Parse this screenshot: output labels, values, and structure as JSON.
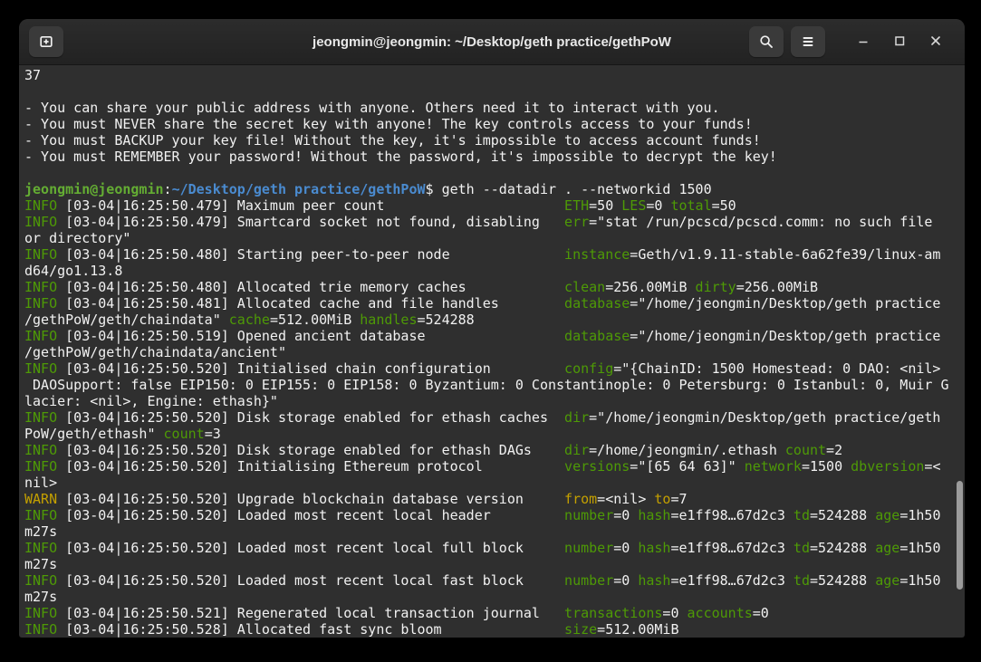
{
  "window": {
    "title": "jeongmin@jeongmin: ~/Desktop/geth practice/gethPoW",
    "controls": [
      "new-tab",
      "search",
      "menu",
      "minimize",
      "maximize",
      "close"
    ]
  },
  "colors": {
    "desktop_bg": "#000000",
    "terminal_bg": "#2f2f2f",
    "titlebar_bg": "#262626",
    "titlebar_button_bg": "#3a3a3a",
    "foreground": "#f1f1f1",
    "info_green": "#4e9a06",
    "warn_yellow": "#c4a000",
    "prompt_user_green": "#64ad33",
    "prompt_path_blue": "#4a8bd0",
    "scrollbar_thumb": "#9b9b9b"
  },
  "terminal": {
    "lines": [
      [
        {
          "c": "f",
          "t": "37"
        }
      ],
      [],
      [
        {
          "c": "f",
          "t": "- You can share your public address with anyone. Others need it to interact with you."
        }
      ],
      [
        {
          "c": "f",
          "t": "- You must NEVER share the secret key with anyone! The key controls access to your funds!"
        }
      ],
      [
        {
          "c": "f",
          "t": "- You must BACKUP your key file! Without the key, it's impossible to access account funds!"
        }
      ],
      [
        {
          "c": "f",
          "t": "- You must REMEMBER your password! Without the password, it's impossible to decrypt the key!"
        }
      ],
      [],
      [
        {
          "c": "u",
          "t": "jeongmin@jeongmin"
        },
        {
          "c": "f",
          "t": ":"
        },
        {
          "c": "p",
          "t": "~/Desktop/geth practice/gethPoW"
        },
        {
          "c": "f",
          "t": "$ geth --datadir . --networkid 1500"
        }
      ],
      [
        {
          "c": "i",
          "t": "INFO"
        },
        {
          "c": "f",
          "t": " [03-04|16:25:50.479] Maximum peer count",
          "pad": 66
        },
        {
          "c": "k",
          "t": "ETH"
        },
        {
          "c": "f",
          "t": "=50 "
        },
        {
          "c": "k",
          "t": "LES"
        },
        {
          "c": "f",
          "t": "=0 "
        },
        {
          "c": "k",
          "t": "total"
        },
        {
          "c": "f",
          "t": "=50"
        }
      ],
      [
        {
          "c": "i",
          "t": "INFO"
        },
        {
          "c": "f",
          "t": " [03-04|16:25:50.479] Smartcard socket not found, disabling",
          "pad": 66
        },
        {
          "c": "k",
          "t": "err"
        },
        {
          "c": "f",
          "t": "=\"stat /run/pcscd/pcscd.comm: no such file"
        }
      ],
      [
        {
          "c": "f",
          "t": "or directory\""
        }
      ],
      [
        {
          "c": "i",
          "t": "INFO"
        },
        {
          "c": "f",
          "t": " [03-04|16:25:50.480] Starting peer-to-peer node",
          "pad": 66
        },
        {
          "c": "k",
          "t": "instance"
        },
        {
          "c": "f",
          "t": "=Geth/v1.9.11-stable-6a62fe39/linux-am"
        }
      ],
      [
        {
          "c": "f",
          "t": "d64/go1.13.8"
        }
      ],
      [
        {
          "c": "i",
          "t": "INFO"
        },
        {
          "c": "f",
          "t": " [03-04|16:25:50.480] Allocated trie memory caches",
          "pad": 66
        },
        {
          "c": "k",
          "t": "clean"
        },
        {
          "c": "f",
          "t": "=256.00MiB "
        },
        {
          "c": "k",
          "t": "dirty"
        },
        {
          "c": "f",
          "t": "=256.00MiB"
        }
      ],
      [
        {
          "c": "i",
          "t": "INFO"
        },
        {
          "c": "f",
          "t": " [03-04|16:25:50.481] Allocated cache and file handles",
          "pad": 66
        },
        {
          "c": "k",
          "t": "database"
        },
        {
          "c": "f",
          "t": "=\"/home/jeongmin/Desktop/geth practice"
        }
      ],
      [
        {
          "c": "f",
          "t": "/gethPoW/geth/chaindata\" "
        },
        {
          "c": "k",
          "t": "cache"
        },
        {
          "c": "f",
          "t": "=512.00MiB "
        },
        {
          "c": "k",
          "t": "handles"
        },
        {
          "c": "f",
          "t": "=524288"
        }
      ],
      [
        {
          "c": "i",
          "t": "INFO"
        },
        {
          "c": "f",
          "t": " [03-04|16:25:50.519] Opened ancient database",
          "pad": 66
        },
        {
          "c": "k",
          "t": "database"
        },
        {
          "c": "f",
          "t": "=\"/home/jeongmin/Desktop/geth practice"
        }
      ],
      [
        {
          "c": "f",
          "t": "/gethPoW/geth/chaindata/ancient\""
        }
      ],
      [
        {
          "c": "i",
          "t": "INFO"
        },
        {
          "c": "f",
          "t": " [03-04|16:25:50.520] Initialised chain configuration",
          "pad": 66
        },
        {
          "c": "k",
          "t": "config"
        },
        {
          "c": "f",
          "t": "=\"{ChainID: 1500 Homestead: 0 DAO: <nil>"
        }
      ],
      [
        {
          "c": "f",
          "t": " DAOSupport: false EIP150: 0 EIP155: 0 EIP158: 0 Byzantium: 0 Constantinople: 0 Petersburg: 0 Istanbul: 0, Muir G"
        }
      ],
      [
        {
          "c": "f",
          "t": "lacier: <nil>, Engine: ethash}\""
        }
      ],
      [
        {
          "c": "i",
          "t": "INFO"
        },
        {
          "c": "f",
          "t": " [03-04|16:25:50.520] Disk storage enabled for ethash caches",
          "pad": 66
        },
        {
          "c": "k",
          "t": "dir"
        },
        {
          "c": "f",
          "t": "=\"/home/jeongmin/Desktop/geth practice/geth"
        }
      ],
      [
        {
          "c": "f",
          "t": "PoW/geth/ethash\" "
        },
        {
          "c": "k",
          "t": "count"
        },
        {
          "c": "f",
          "t": "=3"
        }
      ],
      [
        {
          "c": "i",
          "t": "INFO"
        },
        {
          "c": "f",
          "t": " [03-04|16:25:50.520] Disk storage enabled for ethash DAGs",
          "pad": 66
        },
        {
          "c": "k",
          "t": "dir"
        },
        {
          "c": "f",
          "t": "=/home/jeongmin/.ethash "
        },
        {
          "c": "k",
          "t": "count"
        },
        {
          "c": "f",
          "t": "=2"
        }
      ],
      [
        {
          "c": "i",
          "t": "INFO"
        },
        {
          "c": "f",
          "t": " [03-04|16:25:50.520] Initialising Ethereum protocol",
          "pad": 66
        },
        {
          "c": "k",
          "t": "versions"
        },
        {
          "c": "f",
          "t": "=\"[65 64 63]\" "
        },
        {
          "c": "k",
          "t": "network"
        },
        {
          "c": "f",
          "t": "=1500 "
        },
        {
          "c": "k",
          "t": "dbversion"
        },
        {
          "c": "f",
          "t": "=<"
        }
      ],
      [
        {
          "c": "f",
          "t": "nil>"
        }
      ],
      [
        {
          "c": "w",
          "t": "WARN"
        },
        {
          "c": "f",
          "t": " [03-04|16:25:50.520] Upgrade blockchain database version",
          "pad": 66
        },
        {
          "c": "y",
          "t": "from"
        },
        {
          "c": "f",
          "t": "=<nil> "
        },
        {
          "c": "y",
          "t": "to"
        },
        {
          "c": "f",
          "t": "=7"
        }
      ],
      [
        {
          "c": "i",
          "t": "INFO"
        },
        {
          "c": "f",
          "t": " [03-04|16:25:50.520] Loaded most recent local header",
          "pad": 66
        },
        {
          "c": "k",
          "t": "number"
        },
        {
          "c": "f",
          "t": "=0 "
        },
        {
          "c": "k",
          "t": "hash"
        },
        {
          "c": "f",
          "t": "=e1ff98…67d2c3 "
        },
        {
          "c": "k",
          "t": "td"
        },
        {
          "c": "f",
          "t": "=524288 "
        },
        {
          "c": "k",
          "t": "age"
        },
        {
          "c": "f",
          "t": "=1h50"
        }
      ],
      [
        {
          "c": "f",
          "t": "m27s"
        }
      ],
      [
        {
          "c": "i",
          "t": "INFO"
        },
        {
          "c": "f",
          "t": " [03-04|16:25:50.520] Loaded most recent local full block",
          "pad": 66
        },
        {
          "c": "k",
          "t": "number"
        },
        {
          "c": "f",
          "t": "=0 "
        },
        {
          "c": "k",
          "t": "hash"
        },
        {
          "c": "f",
          "t": "=e1ff98…67d2c3 "
        },
        {
          "c": "k",
          "t": "td"
        },
        {
          "c": "f",
          "t": "=524288 "
        },
        {
          "c": "k",
          "t": "age"
        },
        {
          "c": "f",
          "t": "=1h50"
        }
      ],
      [
        {
          "c": "f",
          "t": "m27s"
        }
      ],
      [
        {
          "c": "i",
          "t": "INFO"
        },
        {
          "c": "f",
          "t": " [03-04|16:25:50.520] Loaded most recent local fast block",
          "pad": 66
        },
        {
          "c": "k",
          "t": "number"
        },
        {
          "c": "f",
          "t": "=0 "
        },
        {
          "c": "k",
          "t": "hash"
        },
        {
          "c": "f",
          "t": "=e1ff98…67d2c3 "
        },
        {
          "c": "k",
          "t": "td"
        },
        {
          "c": "f",
          "t": "=524288 "
        },
        {
          "c": "k",
          "t": "age"
        },
        {
          "c": "f",
          "t": "=1h50"
        }
      ],
      [
        {
          "c": "f",
          "t": "m27s"
        }
      ],
      [
        {
          "c": "i",
          "t": "INFO"
        },
        {
          "c": "f",
          "t": " [03-04|16:25:50.521] Regenerated local transaction journal",
          "pad": 66
        },
        {
          "c": "k",
          "t": "transactions"
        },
        {
          "c": "f",
          "t": "=0 "
        },
        {
          "c": "k",
          "t": "accounts"
        },
        {
          "c": "f",
          "t": "=0"
        }
      ],
      [
        {
          "c": "i",
          "t": "INFO"
        },
        {
          "c": "f",
          "t": " [03-04|16:25:50.528] Allocated fast sync bloom",
          "pad": 66
        },
        {
          "c": "k",
          "t": "size"
        },
        {
          "c": "f",
          "t": "=512.00MiB"
        }
      ]
    ]
  }
}
